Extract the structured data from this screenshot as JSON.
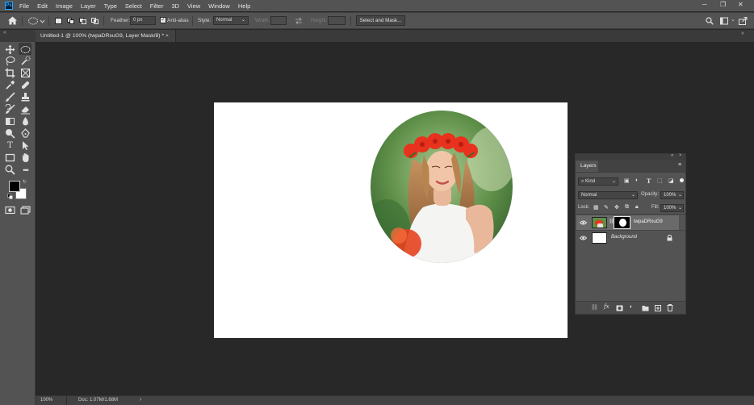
{
  "menu": {
    "logo": "Ps",
    "items": [
      "File",
      "Edit",
      "Image",
      "Layer",
      "Type",
      "Select",
      "Filter",
      "3D",
      "View",
      "Window",
      "Help"
    ]
  },
  "window_controls": {
    "minimize": "─",
    "restore": "❐",
    "close": "✕"
  },
  "options_bar": {
    "feather_label": "Feather:",
    "feather_value": "0 px",
    "anti_alias_label": "Anti-alias",
    "style_label": "Style:",
    "style_value": "Normal",
    "width_label": "Width:",
    "height_label": "Height:",
    "select_mask_button": "Select and Mask..."
  },
  "document": {
    "tab_title": "Untitled-1 @ 100% (twpaDRxuG9, Layer Mask/8) *",
    "tab_close": "×"
  },
  "status_bar": {
    "zoom": "100%",
    "doc_info": "Doc: 1.07M/1.68M",
    "arrow": "›"
  },
  "layers_panel": {
    "title": "Layers",
    "filter_kind": "Kind",
    "blend_mode": "Normal",
    "opacity_label": "Opacity:",
    "opacity_value": "100%",
    "lock_label": "Lock:",
    "fill_label": "Fill:",
    "fill_value": "100%",
    "layers": [
      {
        "name": "twpaDRxuG9",
        "italic": false,
        "visible": true,
        "selected": true
      },
      {
        "name": "Background",
        "italic": true,
        "visible": true,
        "selected": false
      }
    ]
  },
  "colors": {
    "ui_panel": "#535353",
    "workspace": "#282828",
    "canvas": "#ffffff",
    "ps_blue": "#31a8ff",
    "foreground_swatch": "#000000",
    "background_swatch": "#ffffff"
  }
}
